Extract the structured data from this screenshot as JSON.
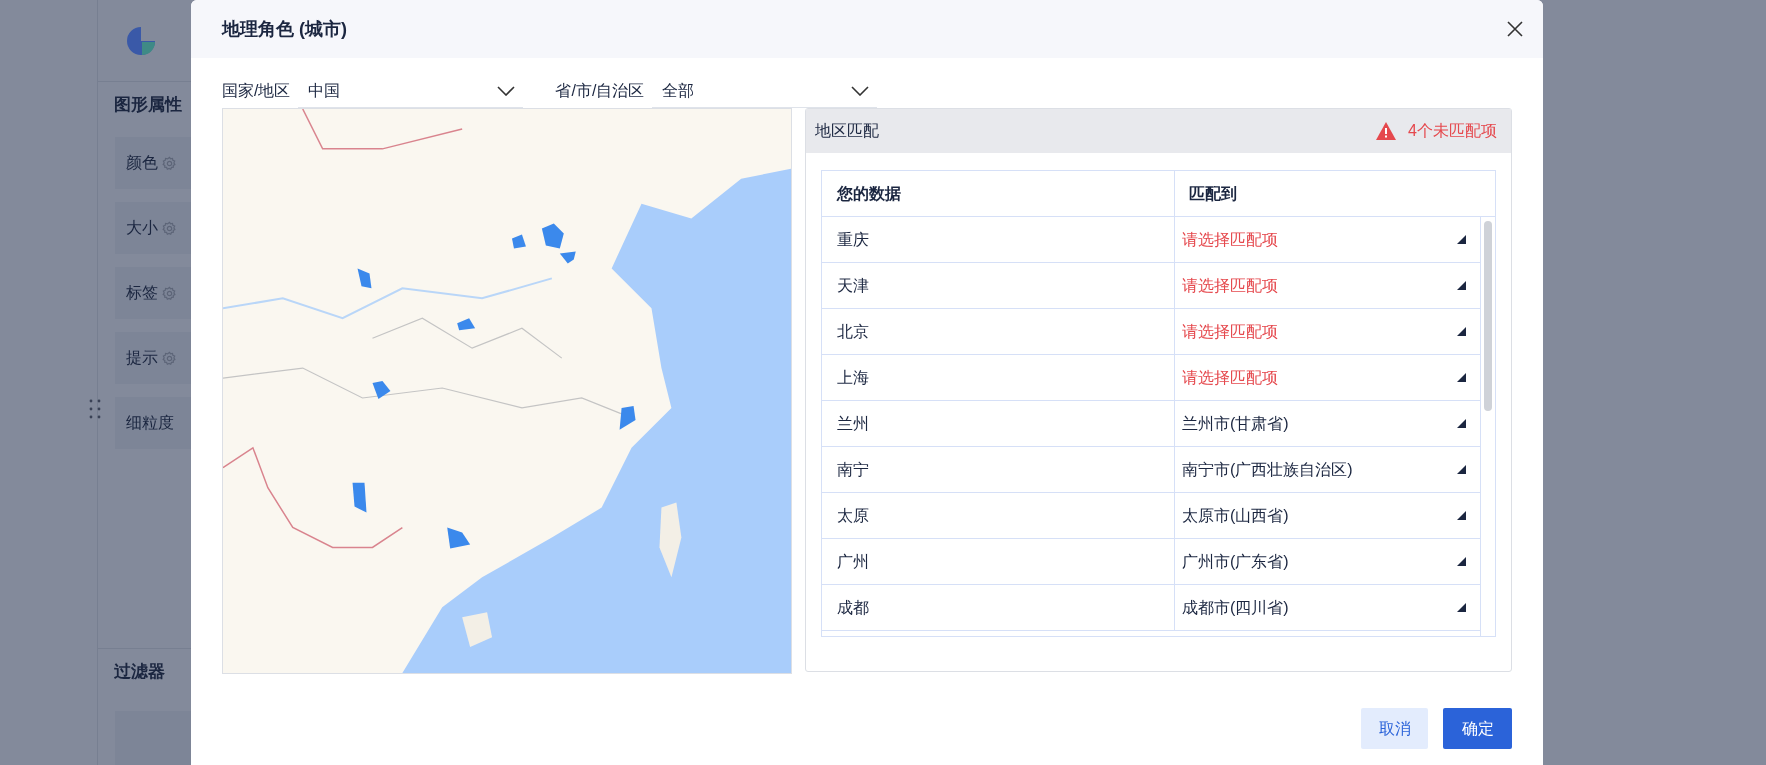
{
  "sidebar": {
    "sections": [
      {
        "title": "图形属性",
        "items": [
          {
            "label": "颜色",
            "kind": "setting"
          },
          {
            "label": "大小",
            "kind": "setting"
          },
          {
            "label": "标签",
            "kind": "setting"
          },
          {
            "label": "提示",
            "kind": "setting"
          },
          {
            "label": "细粒度",
            "kind": "plain"
          }
        ]
      },
      {
        "title": "过滤器"
      }
    ]
  },
  "dialog": {
    "title": "地理角色 (城市)",
    "filters": [
      {
        "label": "国家/地区",
        "value": "中国"
      },
      {
        "label": "省/市/自治区",
        "value": "全部"
      }
    ],
    "match_panel": {
      "title": "地区匹配",
      "warning": "4个未匹配项",
      "columns": [
        "您的数据",
        "匹配到"
      ],
      "rows": [
        {
          "data": "重庆",
          "match": "请选择匹配项",
          "matched": false
        },
        {
          "data": "天津",
          "match": "请选择匹配项",
          "matched": false
        },
        {
          "data": "北京",
          "match": "请选择匹配项",
          "matched": false
        },
        {
          "data": "上海",
          "match": "请选择匹配项",
          "matched": false
        },
        {
          "data": "兰州",
          "match": "兰州市(甘肃省)",
          "matched": true
        },
        {
          "data": "南宁",
          "match": "南宁市(广西壮族自治区)",
          "matched": true
        },
        {
          "data": "太原",
          "match": "太原市(山西省)",
          "matched": true
        },
        {
          "data": "广州",
          "match": "广州市(广东省)",
          "matched": true
        },
        {
          "data": "成都",
          "match": "成都市(四川省)",
          "matched": true
        }
      ]
    },
    "buttons": [
      {
        "label": "取消",
        "kind": "secondary"
      },
      {
        "label": "确定",
        "kind": "primary"
      }
    ]
  }
}
